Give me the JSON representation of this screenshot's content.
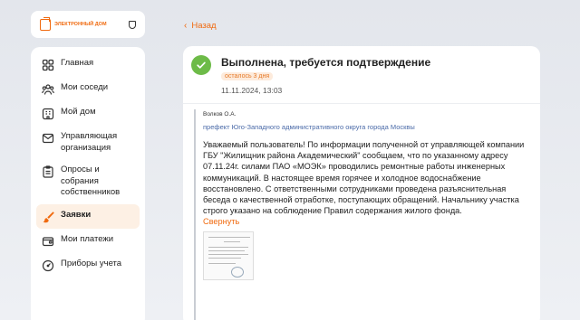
{
  "logo": {
    "text": "ЭЛЕКТРОННЫЙ ДОМ",
    "icon": "logo-house-icon",
    "shield_icon": "shield-icon"
  },
  "sidebar": {
    "items": [
      {
        "label": "Главная",
        "icon": "grid-icon",
        "active": false
      },
      {
        "label": "Мои соседи",
        "icon": "people-icon",
        "active": false
      },
      {
        "label": "Мой дом",
        "icon": "building-icon",
        "active": false
      },
      {
        "label": "Управляющая организация",
        "icon": "mail-icon",
        "active": false
      },
      {
        "label": "Опросы и собрания собственников",
        "icon": "clipboard-icon",
        "active": false
      },
      {
        "label": "Заявки",
        "icon": "brush-icon",
        "active": true
      },
      {
        "label": "Мои платежи",
        "icon": "wallet-icon",
        "active": false
      },
      {
        "label": "Приборы учета",
        "icon": "gauge-icon",
        "active": false
      }
    ]
  },
  "back": {
    "label": "Назад"
  },
  "request": {
    "status_title": "Выполнена, требуется подтверждение",
    "badge": "осталось 3 дня",
    "date": "11.11.2024, 13:03"
  },
  "message": {
    "author": "Волков О.А.",
    "organization": "префект Юго-Западного административного округа города Москвы",
    "text": "Уважаемый пользователь! По информации полученной от управляющей компании ГБУ \"Жилищник района Академический\" сообщаем, что по указанному адресу 07.11.24г. силами ПАО «МОЭК» проводились ремонтные работы инженерных коммуникаций. В настоящее время горячее и холодное водоснабжение восстановлено. С ответственными сотрудниками проведена разъяснительная беседа о качественной отработке, поступающих обращений. Начальнику участка строго указано на соблюдение Правил содержания жилого фонда.",
    "collapse_label": "Свернуть"
  },
  "colors": {
    "accent": "#f06a0f",
    "success": "#6dbb48",
    "active_bg": "#fdf0e4"
  }
}
